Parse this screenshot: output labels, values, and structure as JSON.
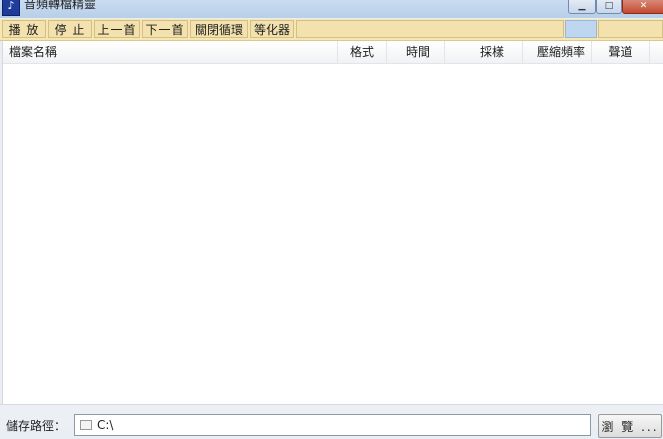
{
  "window": {
    "title": "音頻轉檔精靈",
    "app_icon_glyph": "♪",
    "minimize_glyph": "▁",
    "maximize_glyph": "□",
    "close_glyph": "✕"
  },
  "toolbar": {
    "buttons": [
      "播 放",
      "停 止",
      "上一首",
      "下一首",
      "關閉循環",
      "等化器"
    ]
  },
  "table": {
    "columns": [
      "檔案名稱",
      "格式",
      "時間",
      "採樣",
      "壓縮頻率",
      "聲道"
    ],
    "rows": []
  },
  "footer": {
    "path_label": "儲存路徑：",
    "path_value": "C:\\",
    "browse_label": "瀏 覽 ..."
  },
  "colors": {
    "toolbar_bg": "#f5e6b2",
    "titlebar_bg": "#c9dcf1",
    "close_button": "#c44a30"
  }
}
